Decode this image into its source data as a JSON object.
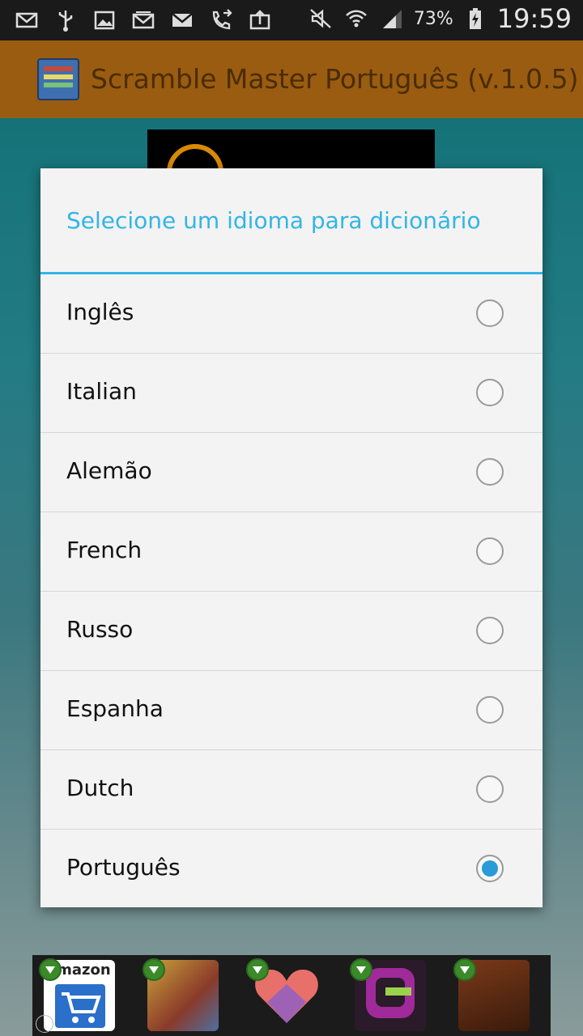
{
  "status_bar": {
    "battery_percent": "73%",
    "time": "19:59",
    "icons": [
      "mail-icon",
      "usb-icon",
      "image-icon",
      "gmail-icon",
      "email-icon",
      "call-forward-icon",
      "upload-icon",
      "mute-icon",
      "wifi-icon",
      "signal-icon",
      "battery-charging-icon"
    ]
  },
  "action_bar": {
    "title": "Scramble Master Português (v.1.0.5)"
  },
  "dialog": {
    "title": "Selecione um idioma para dicionário",
    "options": [
      {
        "label": "Inglês",
        "selected": false
      },
      {
        "label": "Italian",
        "selected": false
      },
      {
        "label": "Alemão",
        "selected": false
      },
      {
        "label": "French",
        "selected": false
      },
      {
        "label": "Russo",
        "selected": false
      },
      {
        "label": "Espanha",
        "selected": false
      },
      {
        "label": "Dutch",
        "selected": false
      },
      {
        "label": "Português",
        "selected": true
      }
    ]
  },
  "ad_strip": {
    "info_label": "i",
    "amazon_label": "amazon"
  },
  "colors": {
    "accent": "#33b5e5",
    "action_bar": "#9a5c10",
    "radio_checked": "#2a9bd6"
  }
}
